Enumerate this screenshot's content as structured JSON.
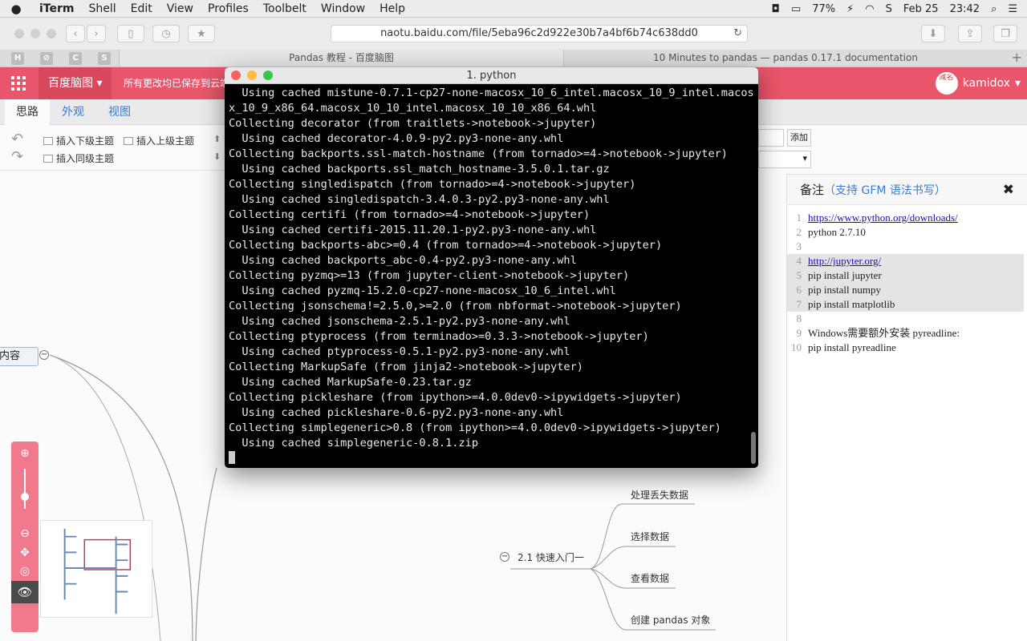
{
  "menubar": {
    "apple": "",
    "app": "iTerm",
    "items": [
      "Shell",
      "Edit",
      "View",
      "Profiles",
      "Toolbelt",
      "Window",
      "Help"
    ],
    "battery": "77%",
    "date": "Feb 25",
    "time": "23:42"
  },
  "browser": {
    "address": "naotu.baidu.com/file/5eba96c2d922e30b7a4bf6b74c638dd0",
    "tabs": [
      "Pandas 教程 - 百度脑图",
      "10 Minutes to pandas — pandas 0.17.1 documentation"
    ],
    "favicons": [
      "H",
      "C",
      "S"
    ],
    "new_tab": "+"
  },
  "naotu": {
    "brand": "百度脑图 ▾",
    "save_status": "所有更改均已保存到云端",
    "user": "kamidox",
    "avatar_text": "咸名",
    "subtabs": [
      "思路",
      "外观",
      "视图"
    ],
    "tools": {
      "insert_child": "插入下级主题",
      "insert_parent": "插入上级主题",
      "insert_sibling": "插入同级主题"
    },
    "add_label": "添加",
    "note": {
      "title": "备注",
      "hint": "（支持 GFM 语法书写）",
      "close": "✖",
      "lines": [
        {
          "n": "1",
          "text": "https://www.python.org/downloads/",
          "link": true,
          "hl": false
        },
        {
          "n": "2",
          "text": "python 2.7.10",
          "link": false,
          "hl": false
        },
        {
          "n": "3",
          "text": "",
          "link": false,
          "hl": false
        },
        {
          "n": "4",
          "text": "http://jupyter.org/",
          "link": true,
          "hl": true
        },
        {
          "n": "5",
          "text": "pip install jupyter",
          "link": false,
          "hl": true
        },
        {
          "n": "6",
          "text": "pip install numpy",
          "link": false,
          "hl": true
        },
        {
          "n": "7",
          "text": "pip install matplotlib",
          "link": false,
          "hl": true
        },
        {
          "n": "8",
          "text": "",
          "link": false,
          "hl": false
        },
        {
          "n": "9",
          "text": "Windows需要额外安装 pyreadline:",
          "link": false,
          "hl": false
        },
        {
          "n": "10",
          "text": "pip install pyreadline",
          "link": false,
          "hl": false
        }
      ]
    },
    "mindmap": {
      "root": "内容",
      "branch": "2.1 快速入门一",
      "leaves": [
        "处理丢失数据",
        "选择数据",
        "查看数据",
        "创建 pandas 对象"
      ]
    },
    "zoom": {
      "in": "⊕",
      "out": "⊖",
      "move": "✥",
      "locate": "◎",
      "eye": "👁"
    }
  },
  "terminal": {
    "title": "1. python",
    "lines": [
      "  Using cached mistune-0.7.1-cp27-none-macosx_10_6_intel.macosx_10_9_intel.macos",
      "x_10_9_x86_64.macosx_10_10_intel.macosx_10_10_x86_64.whl",
      "Collecting decorator (from traitlets->notebook->jupyter)",
      "  Using cached decorator-4.0.9-py2.py3-none-any.whl",
      "Collecting backports.ssl-match-hostname (from tornado>=4->notebook->jupyter)",
      "  Using cached backports.ssl_match_hostname-3.5.0.1.tar.gz",
      "Collecting singledispatch (from tornado>=4->notebook->jupyter)",
      "  Using cached singledispatch-3.4.0.3-py2.py3-none-any.whl",
      "Collecting certifi (from tornado>=4->notebook->jupyter)",
      "  Using cached certifi-2015.11.20.1-py2.py3-none-any.whl",
      "Collecting backports-abc>=0.4 (from tornado>=4->notebook->jupyter)",
      "  Using cached backports_abc-0.4-py2.py3-none-any.whl",
      "Collecting pyzmq>=13 (from jupyter-client->notebook->jupyter)",
      "  Using cached pyzmq-15.2.0-cp27-none-macosx_10_6_intel.whl",
      "Collecting jsonschema!=2.5.0,>=2.0 (from nbformat->notebook->jupyter)",
      "  Using cached jsonschema-2.5.1-py2.py3-none-any.whl",
      "Collecting ptyprocess (from terminado>=0.3.3->notebook->jupyter)",
      "  Using cached ptyprocess-0.5.1-py2.py3-none-any.whl",
      "Collecting MarkupSafe (from jinja2->notebook->jupyter)",
      "  Using cached MarkupSafe-0.23.tar.gz",
      "Collecting pickleshare (from ipython>=4.0.0dev0->ipywidgets->jupyter)",
      "  Using cached pickleshare-0.6-py2.py3-none-any.whl",
      "Collecting simplegeneric>0.8 (from ipython>=4.0.0dev0->ipywidgets->jupyter)",
      "  Using cached simplegeneric-0.8.1.zip"
    ]
  }
}
